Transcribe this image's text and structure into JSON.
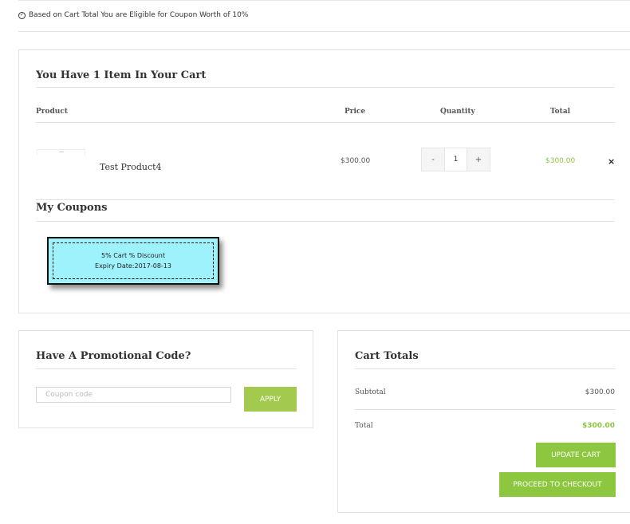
{
  "notice": {
    "icon": "check-circle-icon",
    "text": "Based on Cart Total You are Eligible for Coupon Worth of 10%"
  },
  "cart": {
    "title": "You Have 1 Item In Your Cart",
    "columns": {
      "product": "Product",
      "price": "Price",
      "quantity": "Quantity",
      "total": "Total"
    },
    "items": [
      {
        "name": "Test Product4",
        "price": "$300.00",
        "quantity": "1",
        "minus": "-",
        "plus": "+",
        "total": "$300.00",
        "remove": "×"
      }
    ]
  },
  "coupons": {
    "title": "My Coupons",
    "list": [
      {
        "name": "5% Cart % Discount",
        "expiry": "Expiry Date:2017-08-13"
      }
    ]
  },
  "promo": {
    "title": "Have A Promotional Code?",
    "placeholder": "Coupon code",
    "value": "",
    "apply_label": "APPLY"
  },
  "totals": {
    "title": "Cart Totals",
    "subtotal_label": "Subtotal",
    "subtotal_value": "$300.00",
    "total_label": "Total",
    "total_value": "$300.00",
    "update_label": "UPDATE CART",
    "checkout_label": "PROCEED TO CHECKOUT"
  },
  "colors": {
    "accent": "#8dc63f",
    "apply": "#a3c94f",
    "coupon_bg": "#9ef2fb"
  }
}
